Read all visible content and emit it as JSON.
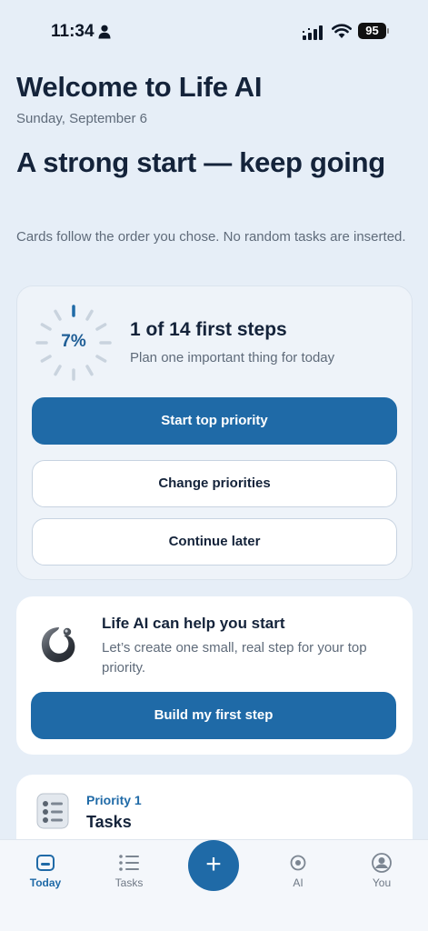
{
  "status_bar": {
    "time": "11:34",
    "battery": "95"
  },
  "header": {
    "title": "Welcome to Life AI",
    "date": "Sunday, September 6"
  },
  "hero": {
    "headline": "A strong start — keep going",
    "subtext": "Cards follow the order you chose. No random tasks are inserted."
  },
  "progress_card": {
    "percent_label": "7%",
    "percent_value": 7,
    "title": "1 of 14 first steps",
    "subtitle": "Plan one important thing for today",
    "primary_button": "Start top priority",
    "change_button": "Change priorities",
    "later_button": "Continue later"
  },
  "ai_card": {
    "title": "Life AI can help you start",
    "description": "Let’s create one small, real step for your top priority.",
    "button": "Build my first step"
  },
  "priority_card": {
    "label": "Priority 1",
    "name": "Tasks"
  },
  "tab_bar": {
    "tabs": [
      {
        "label": "Today",
        "icon": "today-icon",
        "active": true
      },
      {
        "label": "Tasks",
        "icon": "list-icon",
        "active": false
      },
      {
        "label": "AI",
        "icon": "ai-icon",
        "active": false
      },
      {
        "label": "You",
        "icon": "profile-icon",
        "active": false
      }
    ],
    "fab_label": "+"
  },
  "colors": {
    "accent": "#1f6aa7",
    "background": "#e6eef7",
    "text": "#14233a",
    "muted": "#5f6b7a"
  }
}
